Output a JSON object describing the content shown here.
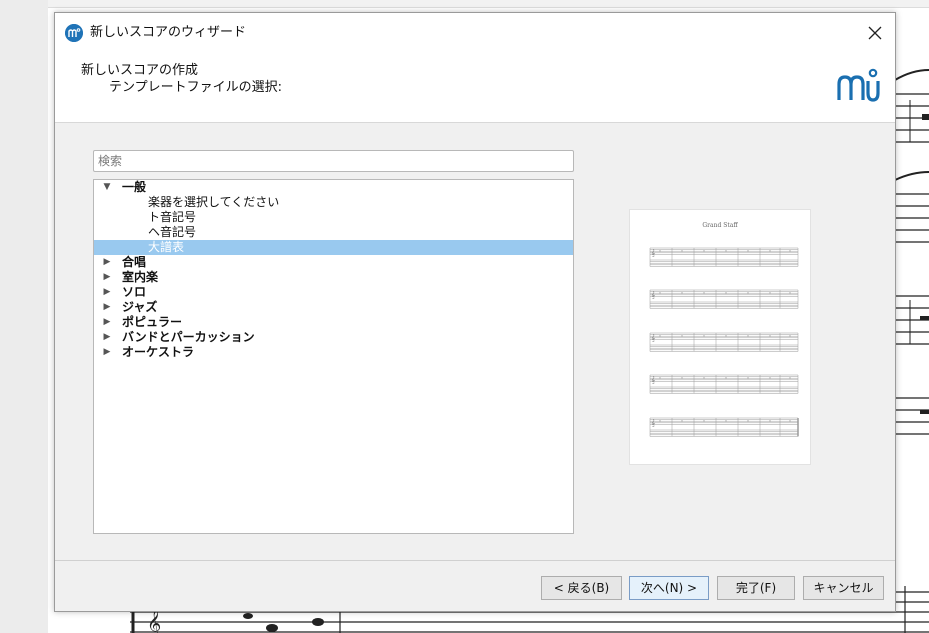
{
  "dialog": {
    "window_title": "新しいスコアのウィザード",
    "header_title": "新しいスコアの作成",
    "header_subtitle": "テンプレートファイルの選択:"
  },
  "search": {
    "placeholder": "検索",
    "value": ""
  },
  "tree": [
    {
      "type": "category",
      "label": "一般",
      "expanded": true
    },
    {
      "type": "template",
      "label": "楽器を選択してください"
    },
    {
      "type": "template",
      "label": "ト音記号"
    },
    {
      "type": "template",
      "label": "ヘ音記号"
    },
    {
      "type": "template",
      "label": "大譜表",
      "selected": true
    },
    {
      "type": "category",
      "label": "合唱",
      "expanded": false
    },
    {
      "type": "category",
      "label": "室内楽",
      "expanded": false
    },
    {
      "type": "category",
      "label": "ソロ",
      "expanded": false
    },
    {
      "type": "category",
      "label": "ジャズ",
      "expanded": false
    },
    {
      "type": "category",
      "label": "ポピュラー",
      "expanded": false
    },
    {
      "type": "category",
      "label": "バンドとパーカッション",
      "expanded": false
    },
    {
      "type": "category",
      "label": "オーケストラ",
      "expanded": false
    }
  ],
  "preview": {
    "title": "Grand Staff"
  },
  "buttons": {
    "back": "< 戻る(B)",
    "next": "次へ(N) >",
    "finish": "完了(F)",
    "cancel": "キャンセル"
  },
  "colors": {
    "selection": "#99c9ef",
    "accent": "#1f73b7",
    "logo": "#1a6fb0"
  },
  "icons": {
    "app": "musescore-icon",
    "close": "close-icon",
    "expanded": "triangle-down-icon",
    "collapsed": "triangle-right-icon"
  }
}
